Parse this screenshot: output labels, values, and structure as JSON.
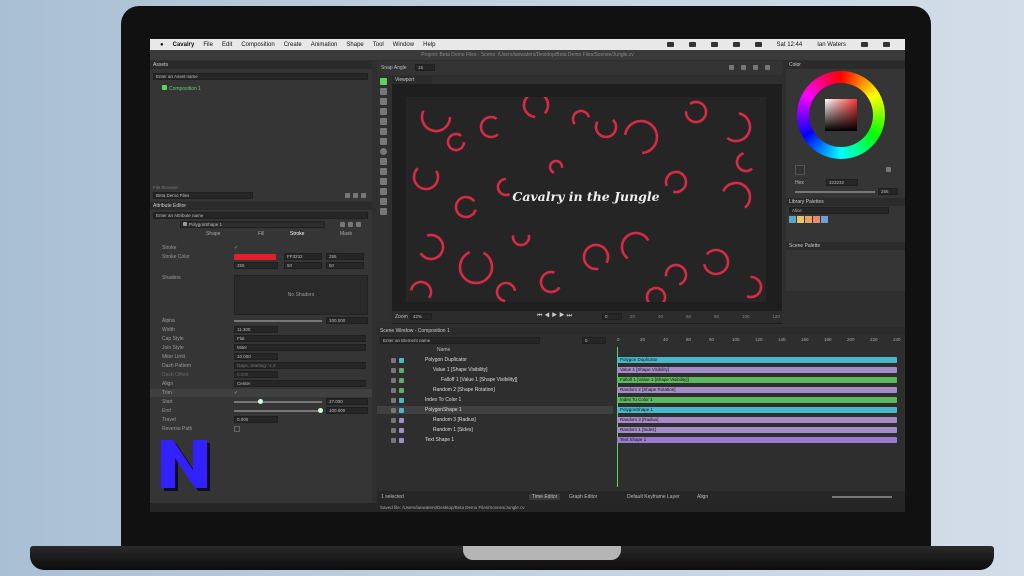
{
  "menubar": {
    "app": "Cavalry",
    "items": [
      "File",
      "Edit",
      "Composition",
      "Create",
      "Animation",
      "Shape",
      "Tool",
      "Window",
      "Help"
    ],
    "clock": "Sat 12:44",
    "user": "Ian Waters"
  },
  "window_title": "Project: Beta Demo Files - Scene: /Users/ianwaters/Desktop/Beta Demo Files/Scenes/Jungle.cv",
  "assets": {
    "title": "Assets",
    "search_placeholder": "Enter an Asset name",
    "items": [
      "Composition 1"
    ]
  },
  "file_browser": {
    "label": "File Browser",
    "path": "Beta Demo Files"
  },
  "attribute_editor": {
    "title": "Attribute Editor",
    "search_placeholder": "Enter an Attribute name",
    "layer_name": "PolygonShape 1",
    "tabs": [
      "Shape",
      "Fill",
      "Stroke",
      "Mask"
    ],
    "stroke_label": "Stroke",
    "stroke_color_label": "Stroke Color",
    "stroke_color_hex": "FF3232",
    "stroke_rgb": [
      "255",
      "50",
      "50"
    ],
    "stroke_swatch": "#e0202a",
    "shaders_label": "Shaders",
    "no_shaders": "No Shaders",
    "alpha": {
      "label": "Alpha",
      "value": "100.000"
    },
    "width": {
      "label": "Width",
      "value": "11.300"
    },
    "cap_style": {
      "label": "Cap Style",
      "value": "Flat"
    },
    "join_style": {
      "label": "Join Style",
      "value": "Miter"
    },
    "miter_limit": {
      "label": "Miter Limit",
      "value": "10.000"
    },
    "dash_pattern": {
      "label": "Dash Pattern",
      "value": "Gaps, Starting: '4,4'"
    },
    "dash_offset": {
      "label": "Dash Offset",
      "value": "0.000"
    },
    "align": {
      "label": "Align",
      "value": "Center"
    },
    "trim": {
      "label": "Trim"
    },
    "start": {
      "label": "Start",
      "value": "27.000"
    },
    "end": {
      "label": "End",
      "value": "100.000"
    },
    "travel": {
      "label": "Travel",
      "value": "0.000"
    },
    "reverse_path": {
      "label": "Reverse Path"
    }
  },
  "viewport": {
    "snap_label": "Snap Angle",
    "snap_value": "15",
    "title": "Viewport",
    "canvas_text": "Cavalry in the Jungle",
    "zoom_label": "Zoom",
    "zoom_value": "42%",
    "frame": "0",
    "accent_color": "#d62b45"
  },
  "color_panel": {
    "title": "Color",
    "hex_label": "Hex",
    "hex_value": "323232",
    "alpha_value": "255",
    "library_title": "Library Palettes",
    "palette_name": "Alice",
    "palette_swatches": [
      "#59a7c4",
      "#e8c56b",
      "#e7a25f",
      "#e98a6c",
      "#6f9fd6"
    ],
    "scene_palette_title": "Scene Palette"
  },
  "scene_window": {
    "title": "Scene Window - Composition 1",
    "search_placeholder": "Enter an Element name",
    "frame_value": "0",
    "name_header": "Name",
    "layers": [
      {
        "name": "Polygon Duplicator",
        "indent": 0,
        "color": "#4bb8c8"
      },
      {
        "name": "Value 1 [Shape Visibility]",
        "indent": 1,
        "color": "#63a968"
      },
      {
        "name": "Falloff 1 [Value 1 [Shape Visibility]]",
        "indent": 2,
        "color": "#63a968"
      },
      {
        "name": "Random 2 [Shape Rotation]",
        "indent": 1,
        "color": "#63a968"
      },
      {
        "name": "Index To Color 1",
        "indent": 0,
        "color": "#4bb8c8"
      },
      {
        "name": "PolygonShape 1",
        "indent": 0,
        "color": "#4bb8c8"
      },
      {
        "name": "Random 3 [Radius]",
        "indent": 1,
        "color": "#a58cc9"
      },
      {
        "name": "Random 1 [Sides]",
        "indent": 1,
        "color": "#a58cc9"
      },
      {
        "name": "Text Shape 1",
        "indent": 0,
        "color": "#a58cc9"
      }
    ],
    "ruler": [
      "0",
      "20",
      "40",
      "60",
      "80",
      "100",
      "120",
      "140",
      "160",
      "180",
      "200",
      "220",
      "240"
    ],
    "tracks": [
      {
        "label": "Polygon Duplicator",
        "color": "#47b8c9"
      },
      {
        "label": "Value 1 [Shape Visibility]",
        "color": "#a58cc9"
      },
      {
        "label": "Falloff 1 [Value 1 [Shape Visibility]]",
        "color": "#5cb85c"
      },
      {
        "label": "Random 2 [Shape Rotation]",
        "color": "#a58cc9"
      },
      {
        "label": "Index To Color 1",
        "color": "#5cb85c"
      },
      {
        "label": "PolygonShape 1",
        "color": "#47b8c9"
      },
      {
        "label": "Random 3 [Radius]",
        "color": "#a58cc9"
      },
      {
        "label": "Random 1 [Sides]",
        "color": "#a58cc9"
      },
      {
        "label": "Text Shape 1",
        "color": "#9b7bd0"
      }
    ],
    "selected_count": "1 selected",
    "time_editor_tab": "Time Editor",
    "graph_editor_tab": "Graph Editor",
    "keyframe_layer": "Default Keyframe Layer",
    "align_label": "Align"
  },
  "status": "Saved file: /Users/ianwaters/Desktop/Beta Demo Files/Scenes/Jungle.cv"
}
